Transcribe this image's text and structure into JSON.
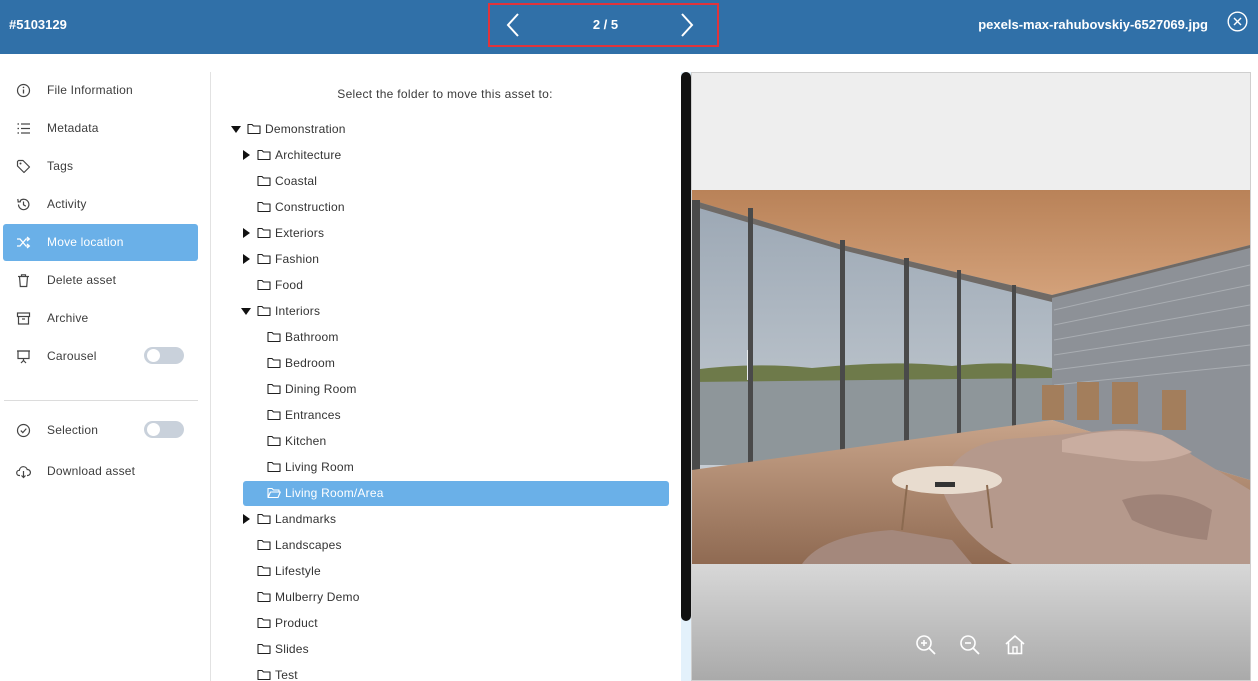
{
  "header": {
    "asset_id": "#5103129",
    "counter": "2 / 5",
    "file_name": "pexels-max-rahubovskiy-6527069.jpg"
  },
  "sidebar": {
    "items": [
      {
        "label": "File Information",
        "icon": "info-icon"
      },
      {
        "label": "Metadata",
        "icon": "list-icon"
      },
      {
        "label": "Tags",
        "icon": "tag-icon"
      },
      {
        "label": "Activity",
        "icon": "history-icon"
      },
      {
        "label": "Move location",
        "icon": "shuffle-icon",
        "active": true
      },
      {
        "label": "Delete asset",
        "icon": "trash-icon"
      },
      {
        "label": "Archive",
        "icon": "archive-icon"
      },
      {
        "label": "Carousel",
        "icon": "presentation-icon",
        "toggle": false
      }
    ],
    "secondary": [
      {
        "label": "Selection",
        "icon": "check-circle-icon",
        "toggle": false
      },
      {
        "label": "Download asset",
        "icon": "cloud-download-icon"
      }
    ]
  },
  "folders": {
    "prompt": "Select the folder to move this asset to:",
    "tree": [
      {
        "label": "Demonstration",
        "depth": 0,
        "caret": "open"
      },
      {
        "label": "Architecture",
        "depth": 1,
        "caret": "closed"
      },
      {
        "label": "Coastal",
        "depth": 1,
        "caret": "none"
      },
      {
        "label": "Construction",
        "depth": 1,
        "caret": "none"
      },
      {
        "label": "Exteriors",
        "depth": 1,
        "caret": "closed"
      },
      {
        "label": "Fashion",
        "depth": 1,
        "caret": "closed"
      },
      {
        "label": "Food",
        "depth": 1,
        "caret": "none"
      },
      {
        "label": "Interiors",
        "depth": 1,
        "caret": "open"
      },
      {
        "label": "Bathroom",
        "depth": 2,
        "caret": "none"
      },
      {
        "label": "Bedroom",
        "depth": 2,
        "caret": "none"
      },
      {
        "label": "Dining Room",
        "depth": 2,
        "caret": "none"
      },
      {
        "label": "Entrances",
        "depth": 2,
        "caret": "none"
      },
      {
        "label": "Kitchen",
        "depth": 2,
        "caret": "none"
      },
      {
        "label": "Living Room",
        "depth": 2,
        "caret": "none"
      },
      {
        "label": "Living Room/Area",
        "depth": 2,
        "caret": "none",
        "selected": true
      },
      {
        "label": "Landmarks",
        "depth": 1,
        "caret": "closed"
      },
      {
        "label": "Landscapes",
        "depth": 1,
        "caret": "none"
      },
      {
        "label": "Lifestyle",
        "depth": 1,
        "caret": "none"
      },
      {
        "label": "Mulberry Demo",
        "depth": 1,
        "caret": "none"
      },
      {
        "label": "Product",
        "depth": 1,
        "caret": "none"
      },
      {
        "label": "Slides",
        "depth": 1,
        "caret": "none"
      },
      {
        "label": "Test",
        "depth": 1,
        "caret": "none"
      }
    ]
  },
  "preview": {
    "controls": [
      "zoom-in-icon",
      "zoom-out-icon",
      "home-icon"
    ]
  },
  "colors": {
    "header": "#3070a8",
    "accent": "#6ab0e8",
    "highlight_border": "#e0343c"
  }
}
